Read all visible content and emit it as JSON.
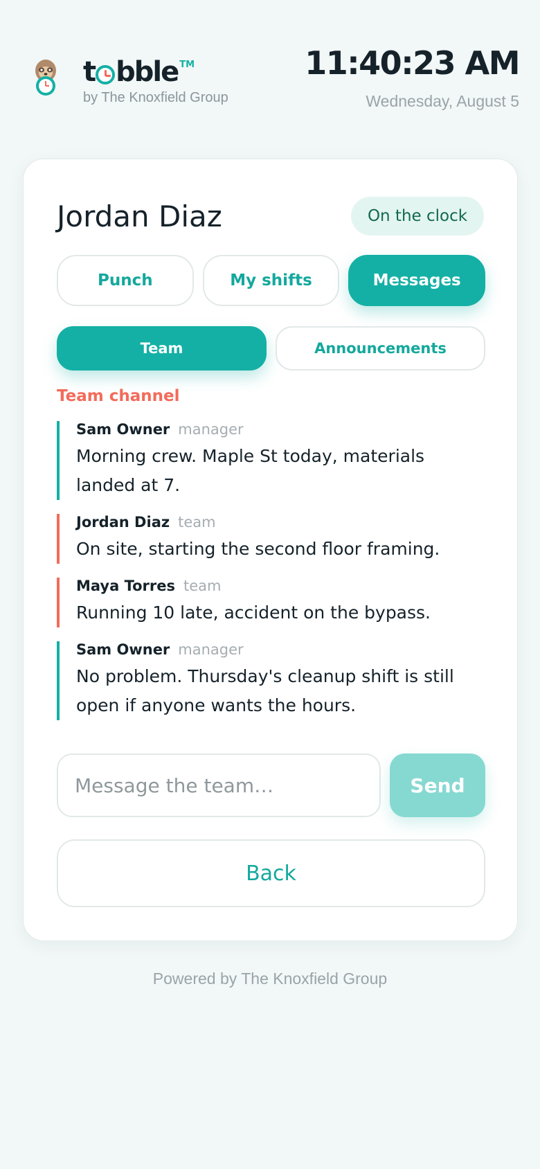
{
  "header": {
    "brand_prefix": "t",
    "brand_suffix": "bble",
    "brand_tm": "TM",
    "brand_subtitle": "by The Knoxfield Group",
    "time": "11:40:23 AM",
    "date": "Wednesday, August 5"
  },
  "card": {
    "user_name": "Jordan Diaz",
    "status": "On the clock",
    "tabs": [
      {
        "label": "Punch",
        "active": false
      },
      {
        "label": "My shifts",
        "active": false
      },
      {
        "label": "Messages",
        "active": true
      }
    ],
    "subtabs": [
      {
        "label": "Team",
        "active": true
      },
      {
        "label": "Announcements",
        "active": false
      }
    ],
    "channel_title": "Team channel",
    "messages": [
      {
        "author": "Sam Owner",
        "role": "manager",
        "text": "Morning crew. Maple St today, materials landed at 7."
      },
      {
        "author": "Jordan Diaz",
        "role": "team",
        "text": "On site, starting the second floor framing."
      },
      {
        "author": "Maya Torres",
        "role": "team",
        "text": "Running 10 late, accident on the bypass."
      },
      {
        "author": "Sam Owner",
        "role": "manager",
        "text": "No problem. Thursday's cleanup shift is still open if anyone wants the hours."
      }
    ],
    "composer": {
      "placeholder": "Message the team…",
      "value": "",
      "send_label": "Send"
    },
    "back_label": "Back"
  },
  "footer": "Powered by The Knoxfield Group",
  "colors": {
    "accent": "#14b0a5",
    "coral": "#f26b5b",
    "status_bg": "#e3f5f1",
    "status_text": "#13694f"
  },
  "icons": {
    "mascot": "sloth-with-clock-icon",
    "brand_o": "clock-icon"
  }
}
